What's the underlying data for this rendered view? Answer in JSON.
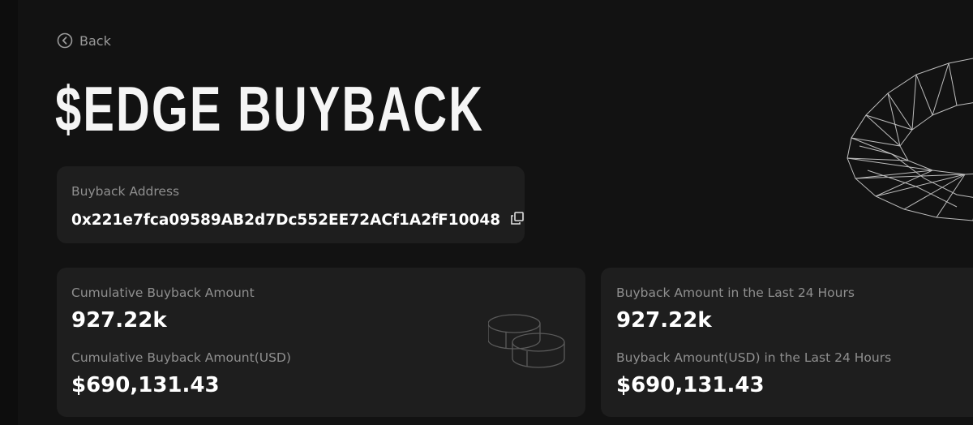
{
  "nav": {
    "back_label": "Back"
  },
  "page": {
    "title": "$EDGE BUYBACK"
  },
  "address_card": {
    "label": "Buyback Address",
    "address": "0x221e7fca09589AB2d7Dc552EE72ACf1A2fF10048",
    "copy_icon": "copy-icon"
  },
  "stats_cumulative": {
    "amount_label": "Cumulative Buyback Amount",
    "amount_value": "927.22k",
    "usd_label": "Cumulative Buyback Amount(USD)",
    "usd_value": "$690,131.43",
    "icon": "coins-icon"
  },
  "stats_24h": {
    "amount_label": "Buyback Amount in the Last 24 Hours",
    "amount_value": "927.22k",
    "usd_label": "Buyback Amount(USD) in the Last 24 Hours",
    "usd_value": "$690,131.43"
  },
  "colors": {
    "background": "#121212",
    "card": "#1e1e1e",
    "label": "#8f8f8f",
    "value": "#ffffff"
  }
}
